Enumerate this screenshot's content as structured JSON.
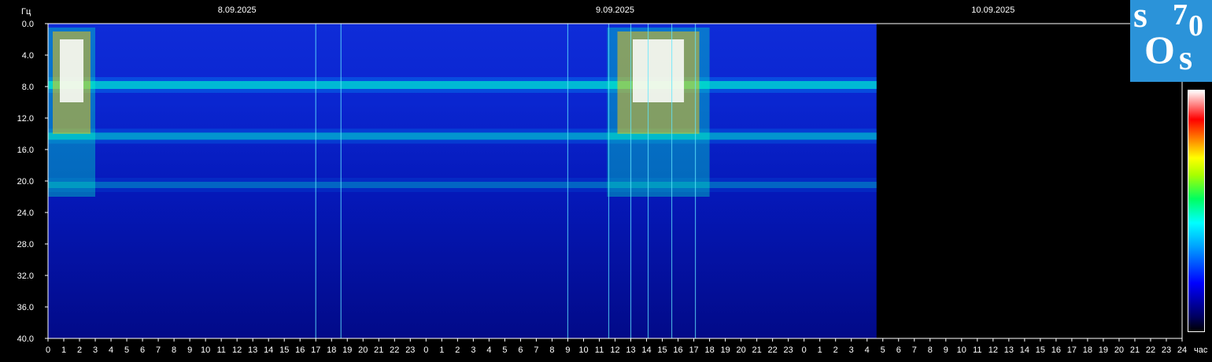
{
  "chart_data": {
    "type": "heatmap",
    "title": "",
    "ylabel": "Гц",
    "xlabel": "час",
    "ylim": [
      0,
      40
    ],
    "y_ticks": [
      "0.0",
      "4.0",
      "8.0",
      "12.0",
      "16.0",
      "20.0",
      "24.0",
      "28.0",
      "32.0",
      "36.0",
      "40.0"
    ],
    "x_ticks": [
      "0",
      "1",
      "2",
      "3",
      "4",
      "5",
      "6",
      "7",
      "8",
      "9",
      "10",
      "11",
      "12",
      "13",
      "14",
      "15",
      "16",
      "17",
      "18",
      "19",
      "20",
      "21",
      "22",
      "23",
      "0",
      "1",
      "2",
      "3",
      "4",
      "5",
      "6",
      "7",
      "8",
      "9",
      "10",
      "11",
      "12",
      "13",
      "14",
      "15",
      "16",
      "17",
      "18",
      "19",
      "20",
      "21",
      "22",
      "23",
      "0",
      "1",
      "2",
      "3",
      "4",
      "5",
      "6",
      "7",
      "8",
      "9",
      "10",
      "11",
      "12",
      "13",
      "14",
      "15",
      "16",
      "17",
      "18",
      "19",
      "20",
      "21",
      "22",
      "23",
      "24"
    ],
    "x_range_hours": [
      0,
      72
    ],
    "data_end_hour": 52.6,
    "dates": [
      {
        "label": "8.09.2025",
        "hour": 12
      },
      {
        "label": "9.09.2025",
        "hour": 36
      },
      {
        "label": "10.09.2025",
        "hour": 60
      }
    ],
    "resonance_bands_hz": [
      7.8,
      14.3,
      20.5
    ],
    "intense_periods_hours": [
      [
        0,
        3
      ],
      [
        35.5,
        42
      ]
    ],
    "colors": {
      "background": "#000000",
      "low": "#0a1fd0",
      "mid": "#00ffff",
      "high": "#ffff00",
      "peak": "#ffffff"
    }
  },
  "logo": {
    "s1": "s",
    "seven": "7",
    "zero": "0",
    "o": "O",
    "s2": "s",
    "color": "#2b93d9"
  }
}
